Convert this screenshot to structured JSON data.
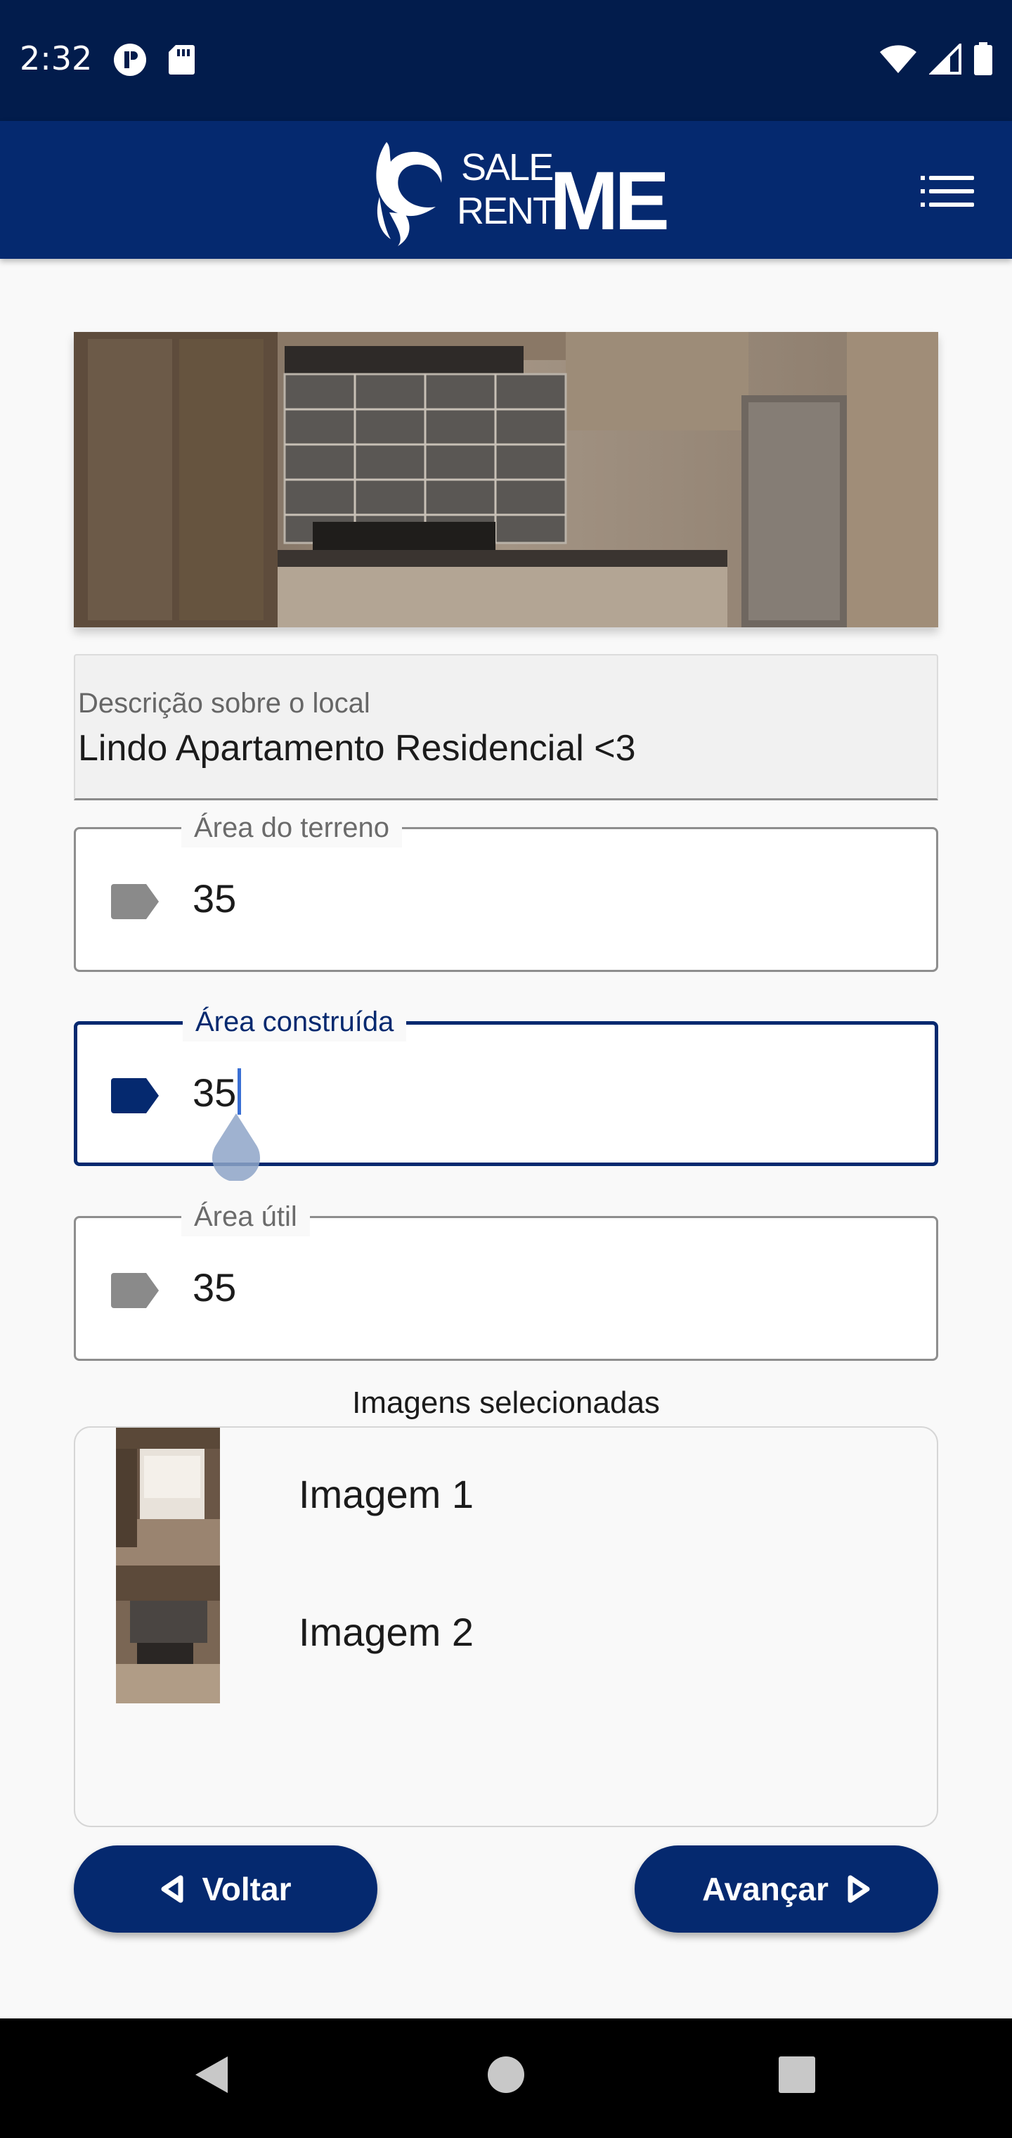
{
  "status_bar": {
    "time": "2:32",
    "left_icons": [
      "privacy-icon",
      "sd-card-icon"
    ],
    "right_icons": [
      "wifi-icon",
      "signal-icon",
      "battery-icon"
    ]
  },
  "app_bar": {
    "logo_text_top": "SALE",
    "logo_text_bottom": "RENT",
    "logo_text_me": "ME",
    "menu_icon": "menu-icon"
  },
  "hero": {
    "image": "kitchen-photo"
  },
  "description": {
    "label": "Descrição sobre o local",
    "value": "Lindo Apartamento Residencial <3"
  },
  "fields": {
    "land_area": {
      "label": "Área do terreno",
      "value": "35",
      "icon": "tag-icon"
    },
    "built_area": {
      "label": "Área construída",
      "value": "35",
      "icon": "tag-icon"
    },
    "useful_area": {
      "label": "Área útil",
      "value": "35",
      "icon": "tag-icon"
    }
  },
  "images": {
    "title": "Imagens selecionadas",
    "items": [
      {
        "label": "Imagem 1"
      },
      {
        "label": "Imagem 2"
      }
    ]
  },
  "buttons": {
    "back_label": "Voltar",
    "next_label": "Avançar"
  },
  "colors": {
    "primary": "#05296f",
    "status_bar": "#021c4c",
    "background": "#f9f9f9",
    "inactive_icon": "#8a8a8a"
  }
}
